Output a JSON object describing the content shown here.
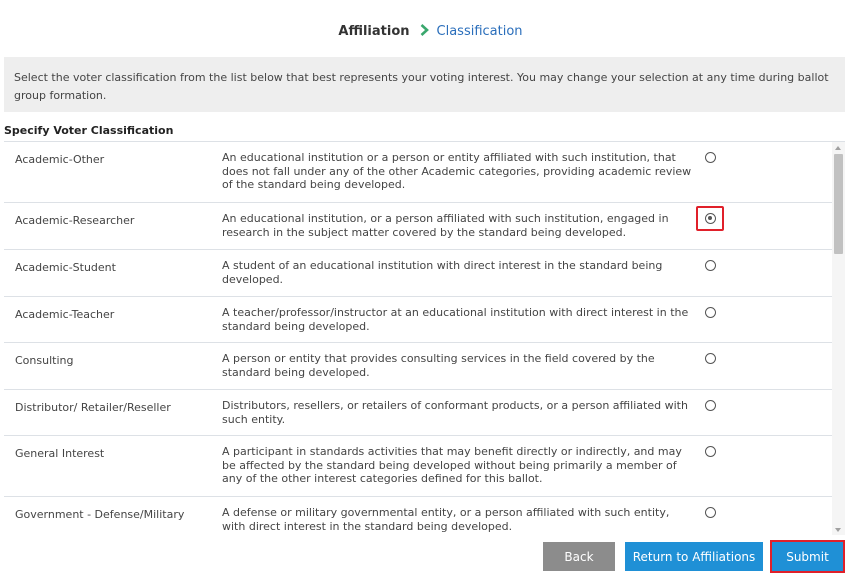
{
  "breadcrumb": {
    "step1": "Affiliation",
    "step2": "Classification"
  },
  "intro_text": "Select the voter classification from the list below that best represents your voting interest. You may change your selection at any time during ballot group formation.",
  "section_title": "Specify Voter Classification",
  "classifications": [
    {
      "name": "Academic-Other",
      "description": "An educational institution or a person or entity affiliated with such institution, that does not fall under any of the other Academic categories, providing academic review of the standard being developed.",
      "selected": false
    },
    {
      "name": "Academic-Researcher",
      "description": "An educational institution, or a person affiliated with such institution, engaged in research in the subject matter covered by the standard being developed.",
      "selected": true
    },
    {
      "name": "Academic-Student",
      "description": "A student of an educational institution with direct interest in the standard being developed.",
      "selected": false
    },
    {
      "name": "Academic-Teacher",
      "description": "A teacher/professor/instructor at an educational institution with direct interest in the standard being developed.",
      "selected": false
    },
    {
      "name": "Consulting",
      "description": "A person or entity that provides consulting services in the field covered by the standard being developed.",
      "selected": false
    },
    {
      "name": "Distributor/ Retailer/Reseller",
      "description": "Distributors, resellers, or retailers of conformant products, or a person affiliated with such entity.",
      "selected": false
    },
    {
      "name": "General Interest",
      "description": "A participant in standards activities that may benefit directly or indirectly, and may be affected by the standard being developed without being primarily a member of any of the other interest categories defined for this ballot.",
      "selected": false
    },
    {
      "name": "Government - Defense/Military",
      "description": "A defense or military governmental entity, or a person affiliated with such entity, with direct interest in the standard being developed.",
      "selected": false
    }
  ],
  "buttons": {
    "back": "Back",
    "return": "Return to Affiliations",
    "submit": "Submit"
  },
  "colors": {
    "link_blue": "#2a6ebb",
    "button_blue": "#1f90d6",
    "button_gray": "#8c8c8c",
    "highlight_red": "#e0202a",
    "chevron_green": "#3aa76d"
  }
}
